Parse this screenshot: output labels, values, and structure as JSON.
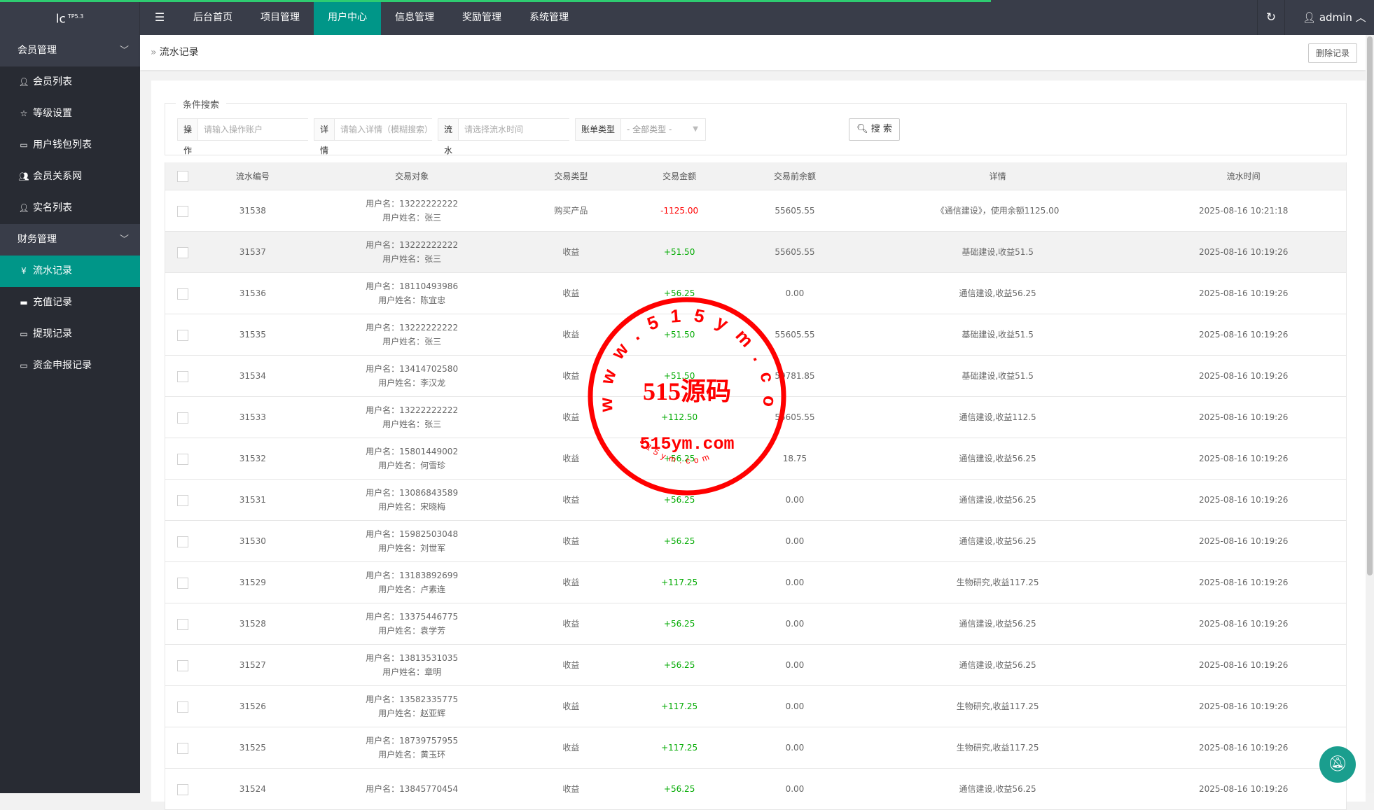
{
  "header": {
    "logo": "lc",
    "logo_version": "TP5.3",
    "nav": [
      "后台首页",
      "项目管理",
      "用户中心",
      "信息管理",
      "奖励管理",
      "系统管理"
    ],
    "active_nav": "用户中心",
    "user": "admin"
  },
  "sidebar": {
    "groups": [
      {
        "label": "会员管理",
        "items": [
          {
            "label": "会员列表",
            "icon": "user-icon"
          },
          {
            "label": "等级设置",
            "icon": "star-icon"
          },
          {
            "label": "用户钱包列表",
            "icon": "card-icon"
          },
          {
            "label": "会员关系网",
            "icon": "users-icon"
          },
          {
            "label": "实名列表",
            "icon": "user-icon"
          }
        ]
      },
      {
        "label": "财务管理",
        "items": [
          {
            "label": "流水记录",
            "icon": "yen-icon",
            "active": true
          },
          {
            "label": "充值记录",
            "icon": "paypal-icon"
          },
          {
            "label": "提现记录",
            "icon": "card-icon"
          },
          {
            "label": "资金申报记录",
            "icon": "card-icon"
          }
        ]
      }
    ]
  },
  "breadcrumb": {
    "current": "流水记录",
    "delete_button": "删除记录"
  },
  "search": {
    "legend": "条件搜索",
    "account": {
      "label": "操作账户",
      "placeholder": "请输入操作账户"
    },
    "detail": {
      "label": "详情",
      "placeholder": "请输入详情（模糊搜索）"
    },
    "time": {
      "label": "流水时间",
      "placeholder": "请选择流水时间"
    },
    "type": {
      "label": "账单类型",
      "selected": "- 全部类型 -"
    },
    "button": "搜 索"
  },
  "table": {
    "headers": [
      "流水编号",
      "交易对象",
      "交易类型",
      "交易金额",
      "交易前余额",
      "详情",
      "流水时间"
    ],
    "user_prefix": "用户名：",
    "name_prefix": "用户姓名：",
    "rows": [
      [
        "31538",
        "13222222222",
        "张三",
        "购买产品",
        "-1125.00",
        "55605.55",
        "《通信建设》，使用余额1125.00",
        "2025-08-16 10:21:18"
      ],
      [
        "31537",
        "13222222222",
        "张三",
        "收益",
        "+51.50",
        "55605.55",
        "基础建设,收益51.5",
        "2025-08-16 10:19:26"
      ],
      [
        "31536",
        "18110493986",
        "陈宜忠",
        "收益",
        "+56.25",
        "0.00",
        "通信建设,收益56.25",
        "2025-08-16 10:19:26"
      ],
      [
        "31535",
        "13222222222",
        "张三",
        "收益",
        "+51.50",
        "55605.55",
        "基础建设,收益51.5",
        "2025-08-16 10:19:26"
      ],
      [
        "31534",
        "13414702580",
        "李汉龙",
        "收益",
        "+51.50",
        "59781.85",
        "基础建设,收益51.5",
        "2025-08-16 10:19:26"
      ],
      [
        "31533",
        "13222222222",
        "张三",
        "收益",
        "+112.50",
        "55605.55",
        "通信建设,收益112.5",
        "2025-08-16 10:19:26"
      ],
      [
        "31532",
        "15801449002",
        "何雪珍",
        "收益",
        "+56.25",
        "18.75",
        "通信建设,收益56.25",
        "2025-08-16 10:19:26"
      ],
      [
        "31531",
        "13086843589",
        "宋晓梅",
        "收益",
        "+56.25",
        "0.00",
        "通信建设,收益56.25",
        "2025-08-16 10:19:26"
      ],
      [
        "31530",
        "15982503048",
        "刘世军",
        "收益",
        "+56.25",
        "0.00",
        "通信建设,收益56.25",
        "2025-08-16 10:19:26"
      ],
      [
        "31529",
        "13183892699",
        "卢素连",
        "收益",
        "+117.25",
        "0.00",
        "生物研究,收益117.25",
        "2025-08-16 10:19:26"
      ],
      [
        "31528",
        "13375446775",
        "袁学芳",
        "收益",
        "+56.25",
        "0.00",
        "通信建设,收益56.25",
        "2025-08-16 10:19:26"
      ],
      [
        "31527",
        "13813531035",
        "章明",
        "收益",
        "+56.25",
        "0.00",
        "通信建设,收益56.25",
        "2025-08-16 10:19:26"
      ],
      [
        "31526",
        "13582335775",
        "赵亚辉",
        "收益",
        "+117.25",
        "0.00",
        "生物研究,收益117.25",
        "2025-08-16 10:19:26"
      ],
      [
        "31525",
        "18739757955",
        "黄玉环",
        "收益",
        "+117.25",
        "0.00",
        "生物研究,收益117.25",
        "2025-08-16 10:19:26"
      ],
      [
        "31524",
        "13845770454",
        "",
        "收益",
        "+56.25",
        "0.00",
        "通信建设,收益56.25",
        "2025-08-16 10:19:26"
      ]
    ]
  },
  "watermark": {
    "ring_text": "www.515ym.com",
    "center_text": "515源码",
    "domain_text": "515ym.com",
    "small_text": "515ym.com"
  },
  "colors": {
    "accent": "#009688",
    "header": "#393d49",
    "sidebar": "#282b33",
    "negative": "#ff0000",
    "positive": "#00aa00",
    "stamp": "#ff0000"
  }
}
